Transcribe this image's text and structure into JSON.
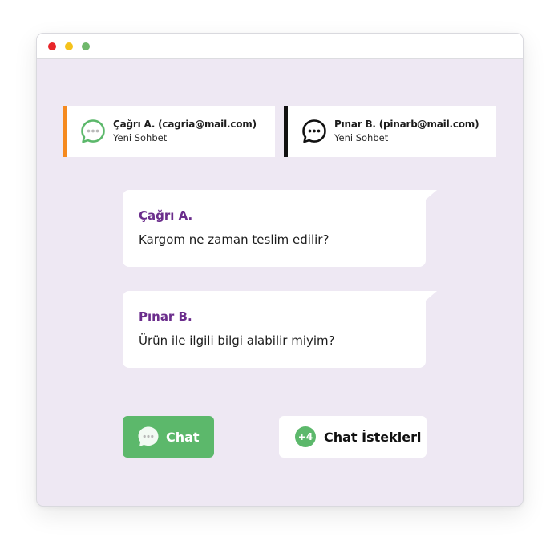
{
  "window": {
    "controls": [
      "close",
      "minimize",
      "maximize"
    ]
  },
  "conversations": [
    {
      "name": "Çağrı A. (cagria@mail.com)",
      "status": "Yeni Sohbet",
      "icon": "chat-bubble-icon",
      "accent": "#f58a1f",
      "icon_color": "#5cb86b"
    },
    {
      "name": "Pınar B. (pinarb@mail.com)",
      "status": "Yeni Sohbet",
      "icon": "chat-bubble-icon",
      "accent": "#111111",
      "icon_color": "#111111"
    }
  ],
  "messages": [
    {
      "sender": "Çağrı A.",
      "text": "Kargom ne zaman teslim edilir?"
    },
    {
      "sender": "Pınar B.",
      "text": "Ürün ile ilgili bilgi alabilir miyim?"
    }
  ],
  "actions": {
    "chat_label": "Chat",
    "chat_icon": "chat-bubble-icon",
    "requests_label": "Chat İstekleri",
    "requests_badge": "+4"
  },
  "colors": {
    "background": "#eee8f3",
    "brand_green": "#5cb86b",
    "sender_purple": "#6b2d8c",
    "accent_orange": "#f58a1f"
  }
}
